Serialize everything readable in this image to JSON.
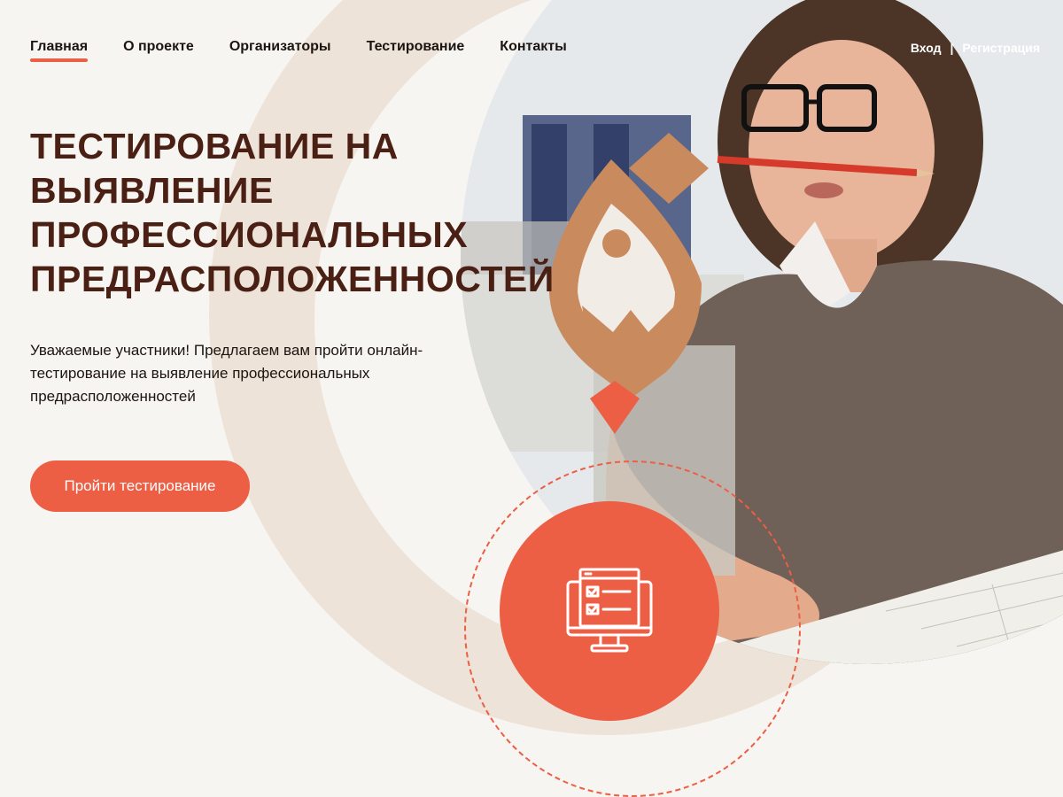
{
  "nav": {
    "items": [
      {
        "label": "Главная",
        "active": true
      },
      {
        "label": "О проекте",
        "active": false
      },
      {
        "label": "Организаторы",
        "active": false
      },
      {
        "label": "Тестирование",
        "active": false
      },
      {
        "label": "Контакты",
        "active": false
      }
    ]
  },
  "auth": {
    "login": "Вход",
    "separator": "|",
    "register": "Регистрация"
  },
  "hero": {
    "title_lines": [
      "ТЕСТИРОВАНИЕ НА",
      "ВЫЯВЛЕНИЕ",
      "ПРОФЕССИОНАЛЬНЫХ",
      "ПРЕДРАСПОЛОЖЕННОСТЕЙ"
    ],
    "description": "Уважаемые участники! Предлагаем вам пройти онлайн-тестирование на выявление профессиональных предрасположенностей",
    "cta_label": "Пройти тестирование"
  },
  "colors": {
    "accent": "#ec5f44",
    "title": "#4a1f14",
    "ring": "#eee3d8",
    "pin": "#c98a5e"
  },
  "icons": {
    "logo": "location-pin-logo-icon",
    "test": "online-test-monitor-icon"
  }
}
